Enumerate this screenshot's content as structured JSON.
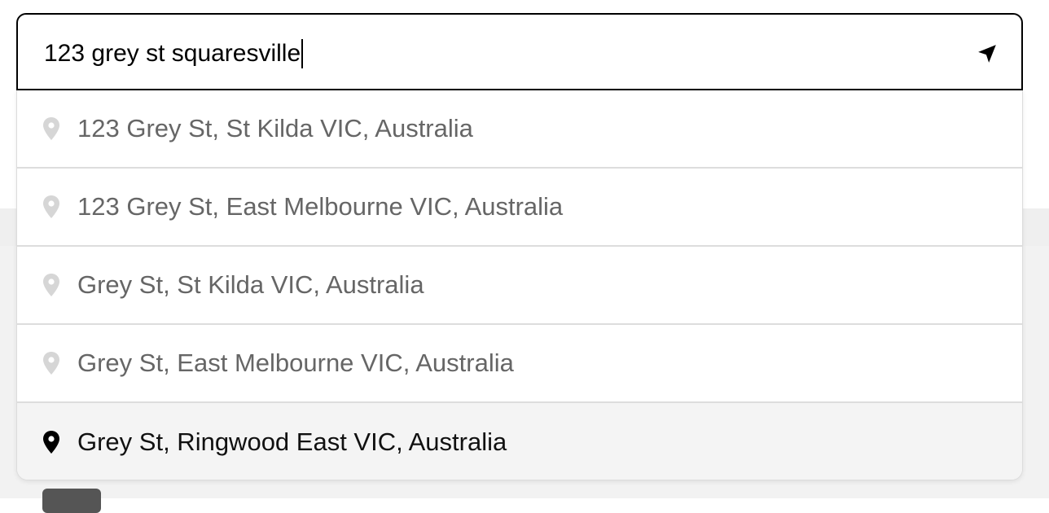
{
  "search": {
    "value": "123 grey st squaresville",
    "location_icon": "navigation-arrow-icon"
  },
  "suggestions": [
    {
      "label": "123 Grey St, St Kilda VIC, Australia",
      "icon": "map-pin-icon",
      "highlighted": false
    },
    {
      "label": "123 Grey St, East Melbourne VIC, Australia",
      "icon": "map-pin-icon",
      "highlighted": false
    },
    {
      "label": "Grey St, St Kilda VIC, Australia",
      "icon": "map-pin-icon",
      "highlighted": false
    },
    {
      "label": "Grey St, East Melbourne VIC, Australia",
      "icon": "map-pin-icon",
      "highlighted": false
    },
    {
      "label": "Grey St, Ringwood East VIC, Australia",
      "icon": "map-pin-icon",
      "highlighted": true
    }
  ],
  "colors": {
    "pin_inactive": "#d6d6d6",
    "pin_active": "#000000",
    "text_inactive": "#666666",
    "text_active": "#111111",
    "highlight_bg": "#f4f4f4"
  }
}
